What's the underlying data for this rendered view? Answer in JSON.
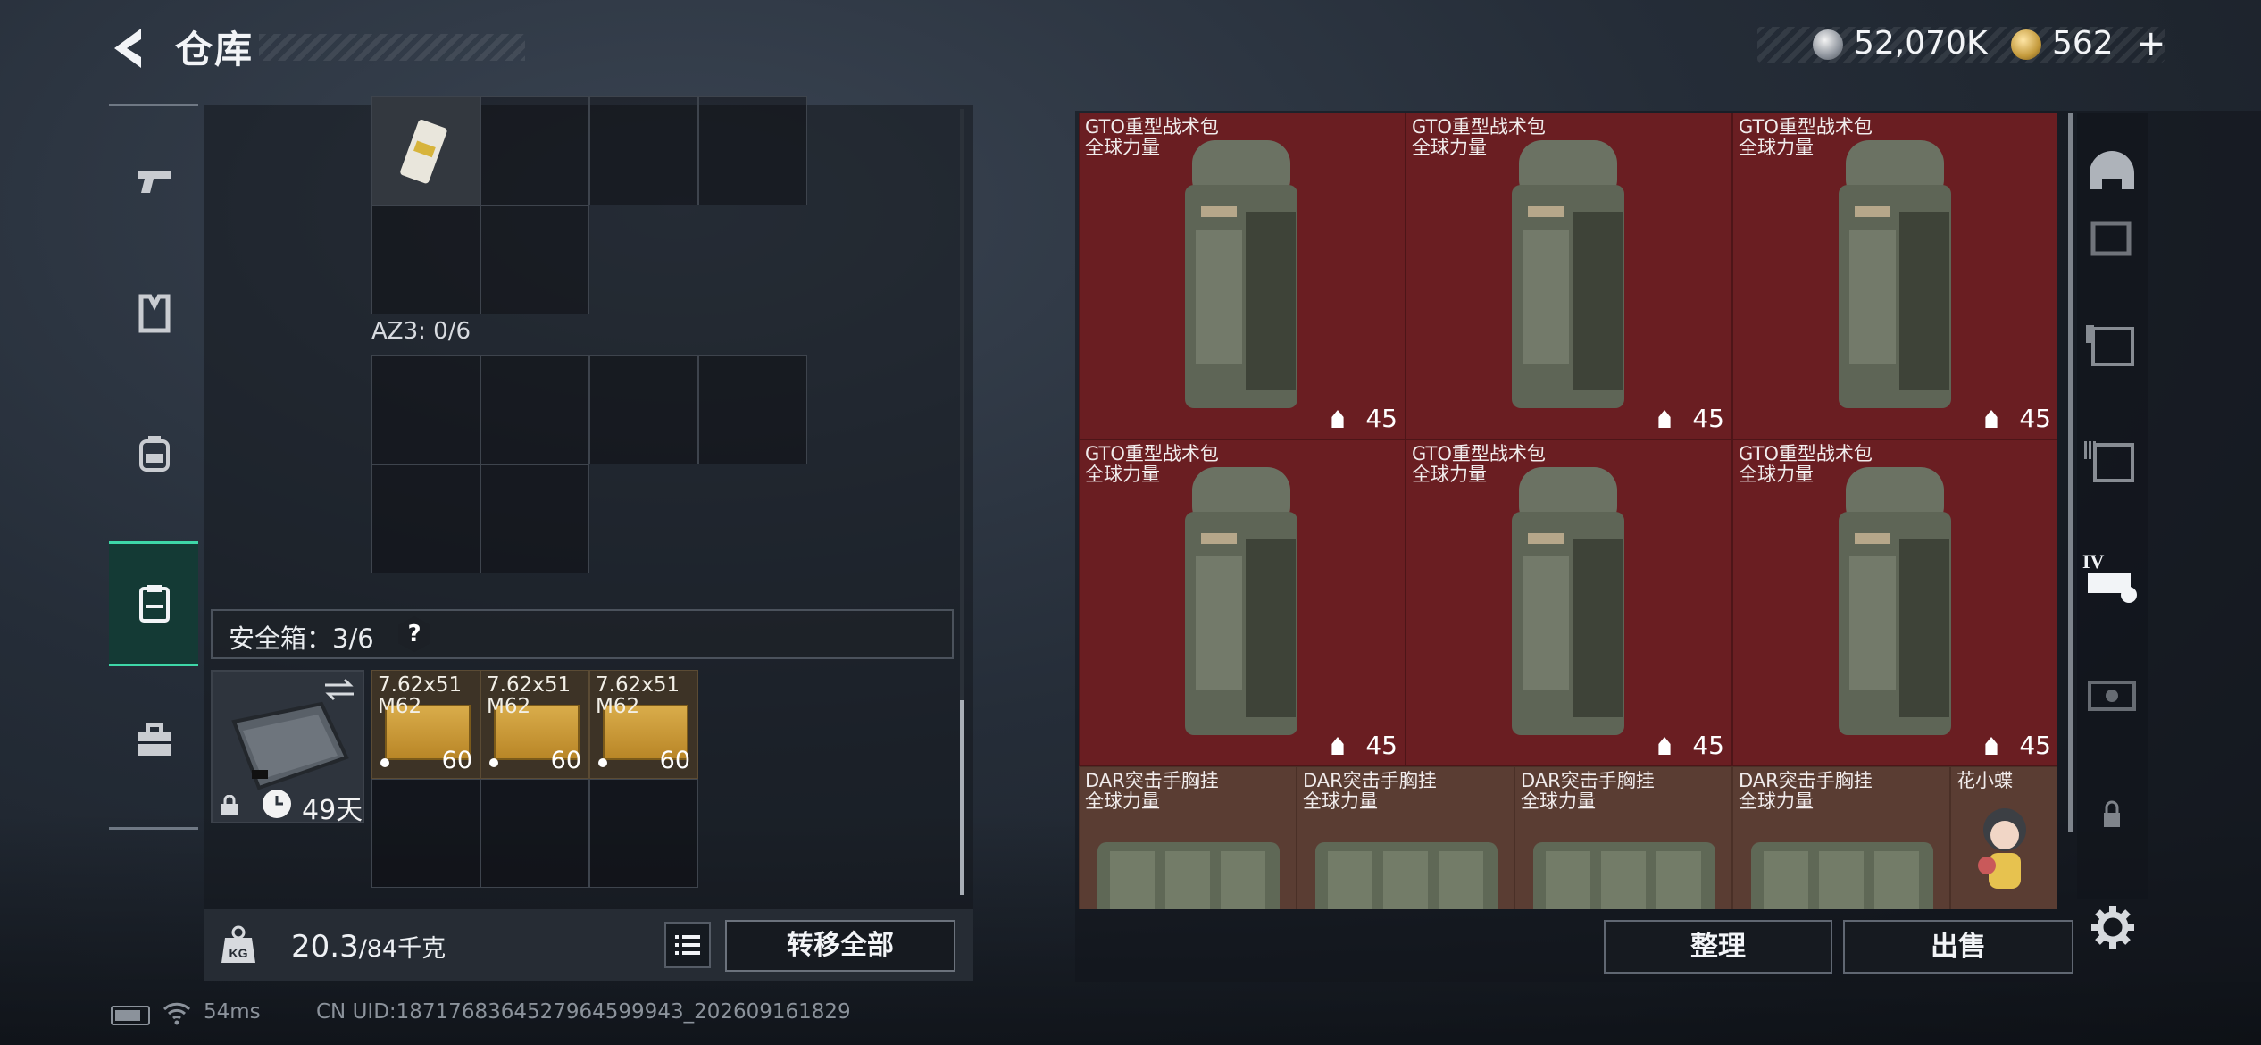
{
  "header": {
    "title": "仓库",
    "currency_silver": "52,070K",
    "currency_gold": "562",
    "currency_plus": "+"
  },
  "left_nav": {
    "items": [
      "pistol-icon",
      "armor-vest-icon",
      "backpack-icon",
      "safe-box-icon",
      "toolbox-icon"
    ],
    "active_index": 3
  },
  "inventory": {
    "container_label": "AZ3: 0/6",
    "safe_box_label": "安全箱：3/6",
    "help": "?",
    "case_days": "49天",
    "ammo": [
      {
        "caliber": "7.62x51\nM62",
        "count": "60"
      },
      {
        "caliber": "7.62x51\nM62",
        "count": "60"
      },
      {
        "caliber": "7.62x51\nM62",
        "count": "60"
      }
    ]
  },
  "footer_left": {
    "weight_value": "20.3",
    "weight_capacity": "/84千克",
    "transfer_all": "转移全部"
  },
  "storage": {
    "slots": [
      {
        "name": "GTO重型战术包\n全球力量",
        "level": "45"
      },
      {
        "name": "GTO重型战术包\n全球力量",
        "level": "45"
      },
      {
        "name": "GTO重型战术包\n全球力量",
        "level": "45"
      },
      {
        "name": "GTO重型战术包\n全球力量",
        "level": "45"
      },
      {
        "name": "GTO重型战术包\n全球力量",
        "level": "45"
      },
      {
        "name": "GTO重型战术包\n全球力量",
        "level": "45"
      }
    ],
    "small_slots": [
      {
        "name": "DAR突击手胸挂\n全球力量"
      },
      {
        "name": "DAR突击手胸挂\n全球力量"
      },
      {
        "name": "DAR突击手胸挂\n全球力量"
      },
      {
        "name": "DAR突击手胸挂\n全球力量"
      },
      {
        "name": "花小蝶"
      }
    ]
  },
  "right_nav": {
    "items": [
      "helmet-icon",
      "rig-icon",
      "rig-ii-icon",
      "rig-iii-icon",
      "rig-iv-icon",
      "rig-v-icon",
      "lock-icon"
    ]
  },
  "footer_right": {
    "sort": "整理",
    "sell": "出售"
  },
  "status": {
    "ping": "54ms",
    "uid": "CN UID:1871768364527964599943_202609161829"
  }
}
